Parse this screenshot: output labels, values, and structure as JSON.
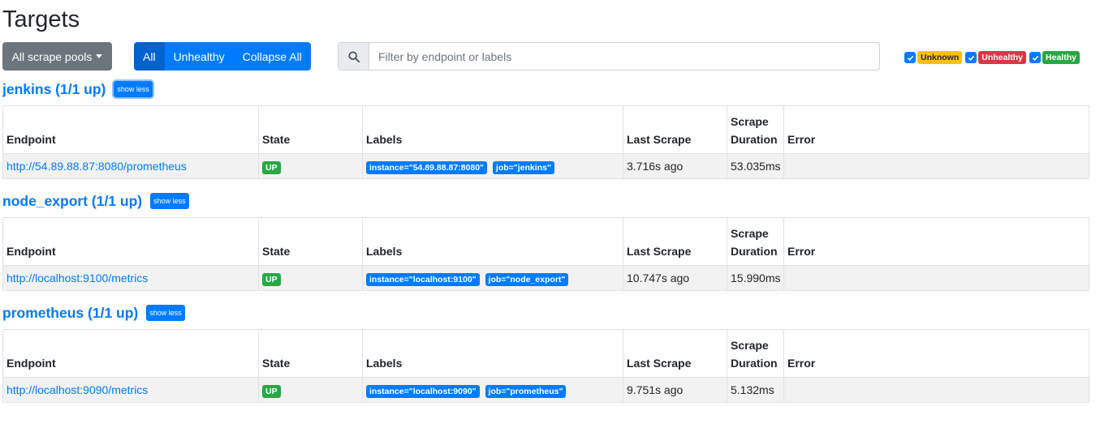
{
  "page": {
    "title": "Targets"
  },
  "toolbar": {
    "scrape_pools_label": "All scrape pools",
    "filter_buttons": [
      "All",
      "Unhealthy",
      "Collapse All"
    ],
    "active_filter": "All",
    "search_placeholder": "Filter by endpoint or labels"
  },
  "health_filters": [
    {
      "label": "Unknown",
      "checked": true,
      "color": "#ffc107"
    },
    {
      "label": "Unhealthy",
      "checked": true,
      "color": "#dc3545"
    },
    {
      "label": "Healthy",
      "checked": true,
      "color": "#28a745"
    }
  ],
  "table_headers": {
    "endpoint": "Endpoint",
    "state": "State",
    "labels": "Labels",
    "last_scrape": "Last Scrape",
    "scrape_duration": "Scrape Duration",
    "error": "Error"
  },
  "pools": [
    {
      "title": "jenkins (1/1 up)",
      "toggle_label": "show less",
      "targets": [
        {
          "endpoint": "http://54.89.88.87:8080/prometheus",
          "state": "UP",
          "labels": [
            "instance=\"54.89.88.87:8080\"",
            "job=\"jenkins\""
          ],
          "last_scrape": "3.716s ago",
          "scrape_duration": "53.035ms",
          "error": ""
        }
      ]
    },
    {
      "title": "node_export (1/1 up)",
      "toggle_label": "show less",
      "targets": [
        {
          "endpoint": "http://localhost:9100/metrics",
          "state": "UP",
          "labels": [
            "instance=\"localhost:9100\"",
            "job=\"node_export\""
          ],
          "last_scrape": "10.747s ago",
          "scrape_duration": "15.990ms",
          "error": ""
        }
      ]
    },
    {
      "title": "prometheus (1/1 up)",
      "toggle_label": "show less",
      "targets": [
        {
          "endpoint": "http://localhost:9090/metrics",
          "state": "UP",
          "labels": [
            "instance=\"localhost:9090\"",
            "job=\"prometheus\""
          ],
          "last_scrape": "9.751s ago",
          "scrape_duration": "5.132ms",
          "error": ""
        }
      ]
    }
  ]
}
